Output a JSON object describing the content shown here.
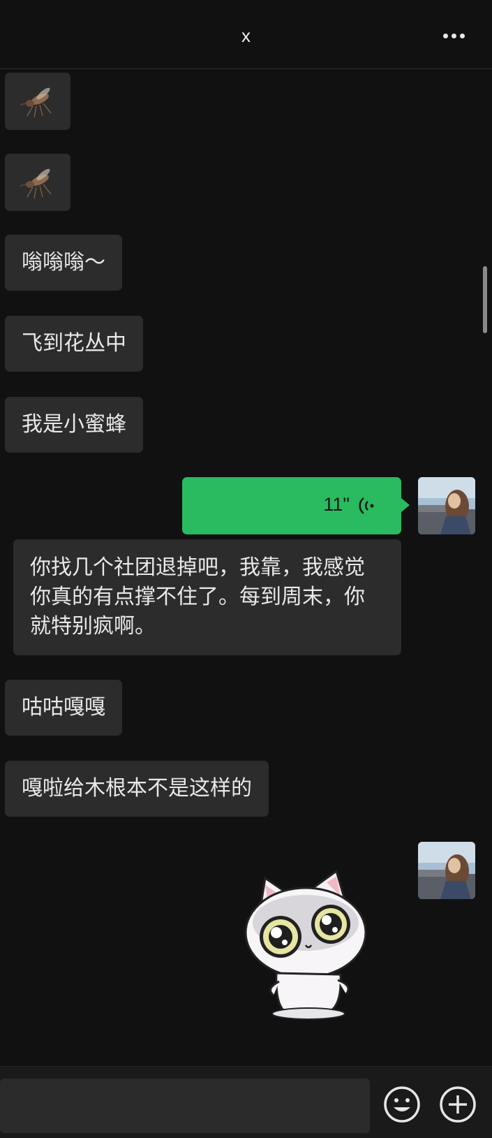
{
  "header": {
    "title": "x",
    "more_icon": "more-horizontal-icon"
  },
  "messages": [
    {
      "side": "left",
      "type": "sticker",
      "icon": "mosquito-sticker"
    },
    {
      "side": "left",
      "type": "sticker",
      "icon": "mosquito-sticker"
    },
    {
      "side": "left",
      "type": "text",
      "text": "嗡嗡嗡～"
    },
    {
      "side": "left",
      "type": "text",
      "text": "飞到花丛中"
    },
    {
      "side": "left",
      "type": "text",
      "text": "我是小蜜蜂"
    },
    {
      "side": "right",
      "type": "voice",
      "duration": "11\"",
      "icon": "voice-wave-icon"
    },
    {
      "side": "left",
      "type": "text",
      "text": "你找几个社团退掉吧，我靠，我感觉你真的有点撑不住了。每到周末，你就特别疯啊。"
    },
    {
      "side": "left",
      "type": "text",
      "text": "咕咕嘎嘎"
    },
    {
      "side": "left",
      "type": "text",
      "text": "嘎啦给木根本不是这样的"
    },
    {
      "side": "right",
      "type": "sticker",
      "icon": "cute-cat-sticker"
    }
  ],
  "input_bar": {
    "emoji_icon": "emoji-smile-icon",
    "plus_icon": "plus-circle-icon"
  },
  "colors": {
    "background": "#111111",
    "bubble_in": "#2c2c2c",
    "bubble_voice": "#2aba5f"
  }
}
